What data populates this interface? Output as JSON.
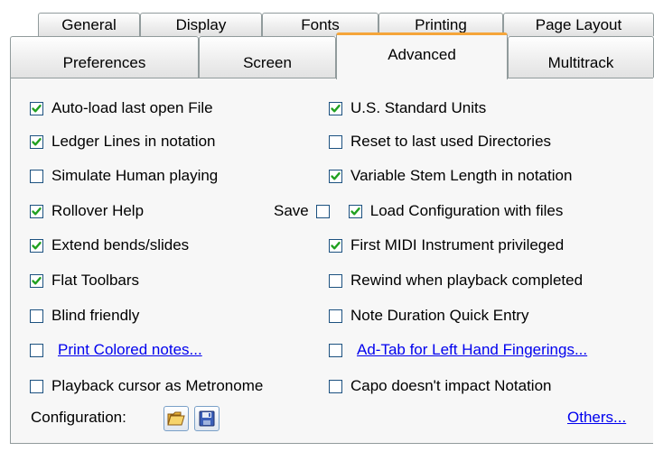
{
  "tabs_back": [
    "General",
    "Display",
    "Fonts",
    "Printing",
    "Page Layout"
  ],
  "tabs_front": [
    "Preferences",
    "Screen",
    "Advanced",
    "Multitrack"
  ],
  "active_tab": "Advanced",
  "left_options": [
    {
      "label": "Auto-load last open File",
      "checked": true
    },
    {
      "label": "Ledger Lines in notation",
      "checked": true
    },
    {
      "label": "Simulate Human playing",
      "checked": false
    },
    {
      "label": "Rollover Help",
      "checked": true
    },
    {
      "label": "Extend bends/slides",
      "checked": true
    },
    {
      "label": "Flat Toolbars",
      "checked": true
    },
    {
      "label": "Blind friendly",
      "checked": false
    },
    {
      "label": "Print Colored notes...",
      "checked": false
    },
    {
      "label": "Playback cursor as Metronome",
      "checked": false
    }
  ],
  "right_options": [
    {
      "label": "U.S. Standard Units",
      "checked": true
    },
    {
      "label": "Reset to last used Directories",
      "checked": false
    },
    {
      "label": "Variable Stem Length in notation",
      "checked": true
    },
    {
      "label": "Load Configuration with files",
      "checked": true
    },
    {
      "label": "First MIDI Instrument privileged",
      "checked": true
    },
    {
      "label": "Rewind when playback completed",
      "checked": false
    },
    {
      "label": "Note Duration Quick Entry",
      "checked": false
    },
    {
      "label": "Ad-Tab for Left Hand Fingerings...",
      "checked": false
    },
    {
      "label": "Capo doesn't impact Notation",
      "checked": false
    }
  ],
  "save_label": "Save",
  "save_checked": false,
  "configuration_label": "Configuration:",
  "others_link": "Others...",
  "icons": {
    "open": "open-folder-icon",
    "save": "floppy-disk-icon"
  },
  "colors": {
    "accent": "#f5a53a",
    "link": "#0000ee",
    "check": "#21a121",
    "panel": "#f7f7f7"
  }
}
